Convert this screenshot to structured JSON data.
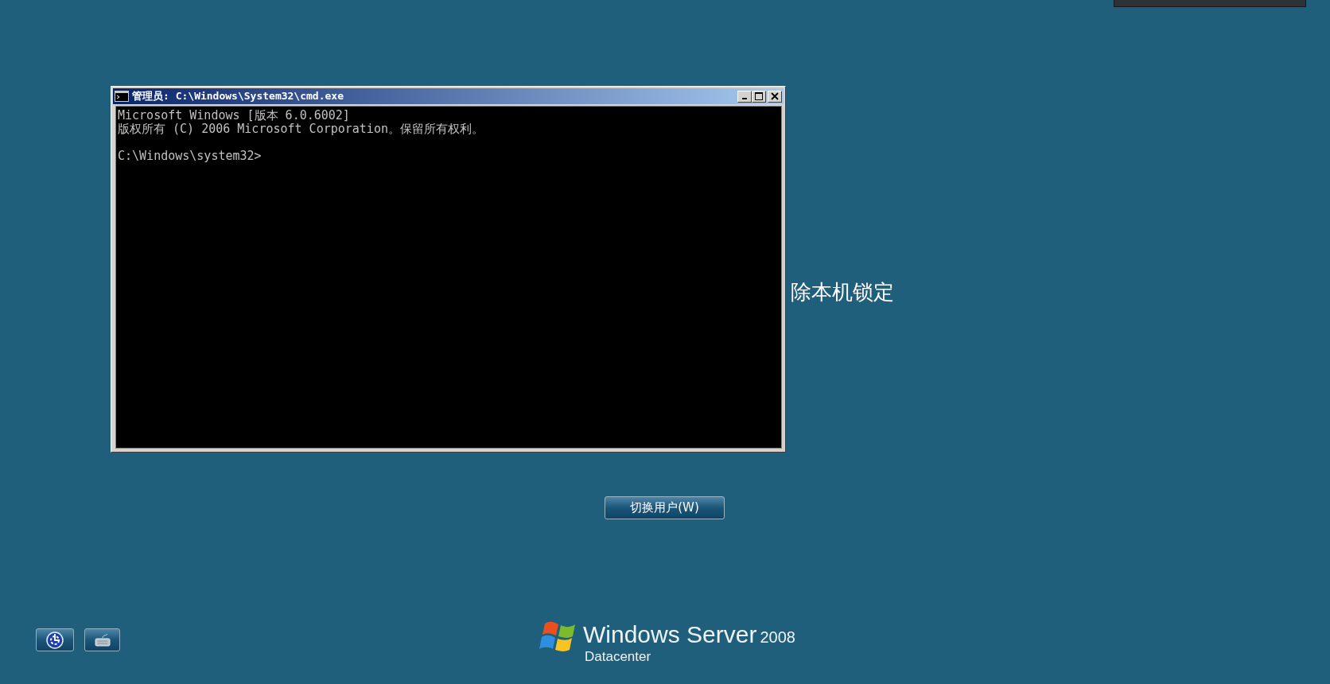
{
  "console_window": {
    "title": "管理员: C:\\Windows\\System32\\cmd.exe",
    "lines": [
      "Microsoft Windows [版本 6.0.6002]",
      "版权所有 (C) 2006 Microsoft Corporation。保留所有权利。"
    ],
    "prompt": "C:\\Windows\\system32>"
  },
  "lock_message": "除本机锁定",
  "switch_user_button": {
    "label": "切换用户(W)"
  },
  "logo": {
    "product": "Windows Server",
    "version": "2008",
    "edition": "Datacenter"
  }
}
